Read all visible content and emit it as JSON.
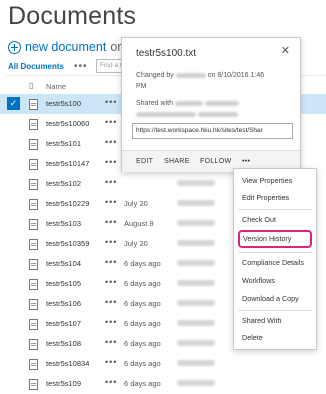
{
  "page": {
    "title": "Documents"
  },
  "toolbar": {
    "new_document": "new document",
    "or_text": "or drag",
    "all_documents": "All Documents",
    "dots": "•••",
    "find_placeholder": "Find a fi"
  },
  "table": {
    "name_header": "Name",
    "rows": [
      {
        "name": "testr5s100",
        "modified": "",
        "selected": true
      },
      {
        "name": "testr5s10060",
        "modified": ""
      },
      {
        "name": "testr5s101",
        "modified": ""
      },
      {
        "name": "testr5s10147",
        "modified": ""
      },
      {
        "name": "testr5s102",
        "modified": ""
      },
      {
        "name": "testr5s10229",
        "modified": "July 20"
      },
      {
        "name": "testr5s103",
        "modified": "August 9"
      },
      {
        "name": "testr5s10359",
        "modified": "July 20"
      },
      {
        "name": "testr5s104",
        "modified": "6 days ago"
      },
      {
        "name": "testr5s105",
        "modified": "6 days ago"
      },
      {
        "name": "testr5s106",
        "modified": "6 days ago"
      },
      {
        "name": "testr5s107",
        "modified": "6 days ago"
      },
      {
        "name": "testr5s108",
        "modified": "6 days ago"
      },
      {
        "name": "testr5s10834",
        "modified": "6 days ago"
      },
      {
        "name": "testr5s109",
        "modified": "6 days ago"
      }
    ]
  },
  "callout": {
    "filename": "testr5s100.txt",
    "close": "✕",
    "changed_by_prefix": "Changed by",
    "changed_on": "on 8/10/2016 1:46",
    "changed_time": "PM",
    "shared_with": "Shared with",
    "url": "https://test.workspace.hku.hk/sites/test/Shar",
    "actions": {
      "edit": "EDIT",
      "share": "SHARE",
      "follow": "FOLLOW",
      "more": "•••"
    }
  },
  "menu": {
    "items": [
      "View Properties",
      "Edit Properties",
      "Check Out",
      "Version History",
      "Compliance Details",
      "Workflows",
      "Download a Copy",
      "Shared With",
      "Delete"
    ],
    "highlighted": "Version History"
  },
  "colors": {
    "accent": "#0072c6",
    "selected_row": "#cde6f7",
    "highlight_border": "#d7267c"
  }
}
